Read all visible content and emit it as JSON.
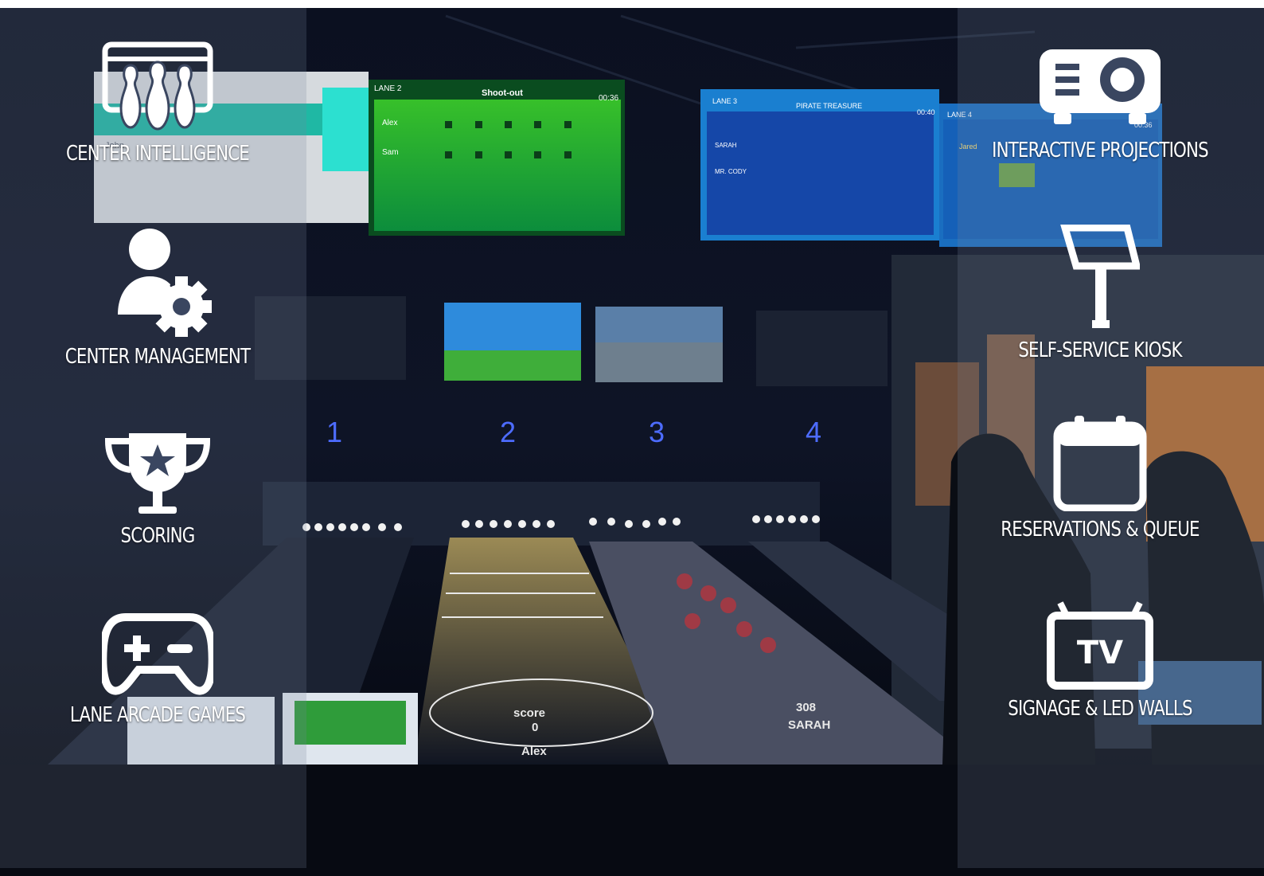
{
  "colors": {
    "accent": "#ffffff",
    "overlay": "#7882a0",
    "background": "#05070f"
  },
  "left_features": [
    {
      "label": "CENTER INTELLIGENCE",
      "icon": "bowling-pins-screen-icon"
    },
    {
      "label": "CENTER MANAGEMENT",
      "icon": "user-gear-icon"
    },
    {
      "label": "SCORING",
      "icon": "trophy-icon"
    },
    {
      "label": "LANE ARCADE GAMES",
      "icon": "gamepad-icon"
    }
  ],
  "right_features": [
    {
      "label": "INTERACTIVE PROJECTIONS",
      "icon": "projector-icon"
    },
    {
      "label": "SELF-SERVICE KIOSK",
      "icon": "kiosk-icon"
    },
    {
      "label": "RESERVATIONS & QUEUE",
      "icon": "calendar-icon"
    },
    {
      "label": "SIGNAGE & LED WALLS",
      "icon": "tv-icon"
    }
  ],
  "scene": {
    "lane_numbers": [
      "1",
      "2",
      "3",
      "4"
    ],
    "screens": [
      {
        "lane": "LANE 2",
        "title": "Shoot-out",
        "time": "00:36",
        "players": [
          "Alex",
          "Sam"
        ]
      },
      {
        "lane": "LANE 3",
        "title": "PIRATE TREASURE",
        "time": "00:40",
        "players": [
          "SARAH",
          "MR. CODY"
        ]
      },
      {
        "lane": "LANE 4",
        "time": "00:36",
        "players": [
          "Jared"
        ]
      }
    ],
    "floor_text": [
      "score",
      "0",
      "Alex",
      "308",
      "SARAH"
    ]
  }
}
